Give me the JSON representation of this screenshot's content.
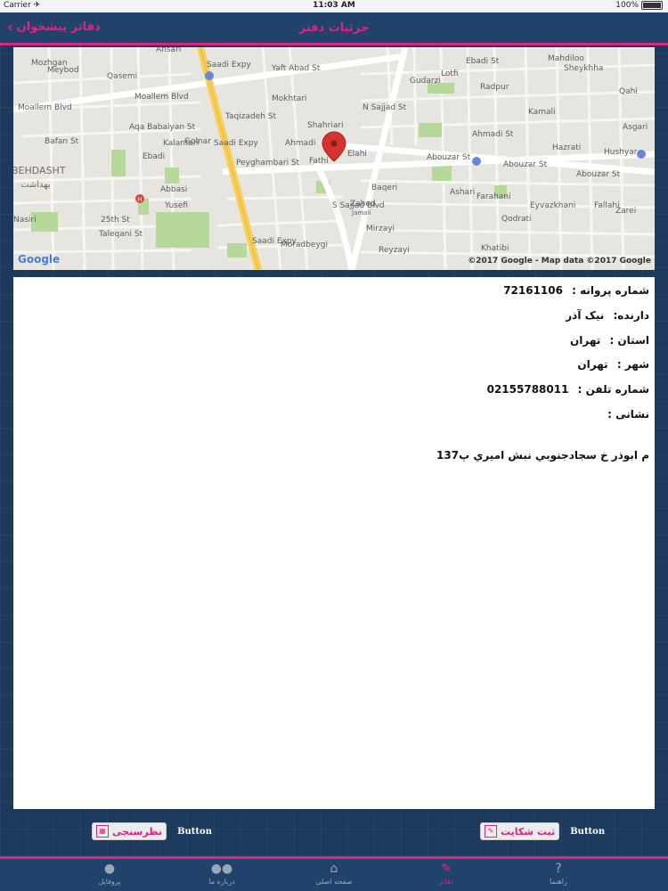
{
  "status_bar": {
    "carrier": "Carrier ✈",
    "time": "11:03 AM",
    "battery": "100%"
  },
  "navbar": {
    "back_label": "دفاتر پیشخوان",
    "title": "جزئیات دفتر"
  },
  "map": {
    "labels": {
      "behdasht": "BEHDASHT",
      "behdasht_fa": "بهداشت",
      "yaft_abad": "Yaft Abad St",
      "qasemi": "Qasemi",
      "moallem": "Moallem Blvd",
      "moallem2": "Moallem Blvd",
      "aqa_babaiyan": "Aqa Babaiyan St",
      "golnar": "Golnar",
      "taqizadeh": "Taqizadeh St",
      "peyghambari": "Peyghambari St",
      "fathi": "Fathi",
      "ahmadi": "Ahmadi",
      "elahi": "Elahi",
      "abouzar1": "Abouzar St",
      "abouzar2": "Abouzar St",
      "abouzar3": "Abouzar St",
      "abbasi": "Abbasi",
      "yusefi": "Yusefi",
      "st25": "25th St",
      "taleqani": "Taleqani St",
      "nasiri": "Nasiri",
      "moradbeygi": "Moradbeygi",
      "reyzayi": "Reyzayi",
      "zahed": "Zahed",
      "baqeri": "Baqeri",
      "mirzayi": "Mirzayi",
      "jamali": "Jamali",
      "lotfi": "Lotfi",
      "radpur": "Radpur",
      "gudarzi": "Gudarzi",
      "ebadi": "Ebadi St",
      "mahdiloo": "Mahdiloo",
      "sheykhha": "Sheykhha",
      "qahi": "Qahi",
      "hazrati": "Hazrati",
      "hushyar": "Hushyar",
      "asgari": "Asgari",
      "kamali": "Kamali",
      "ahmadieh": "Ahmadi St",
      "ashari": "Ashari",
      "farahani": "Farahani",
      "qodrati": "Qodrati",
      "eyvazkhani": "Eyvazkhani",
      "fallahi": "Fallahi",
      "zarei": "Zarei",
      "khatibi": "Khatibi",
      "ansari": "Ansari",
      "mozhgan": "Mozhgan",
      "meybod": "Meybod",
      "bafan": "Bafan St",
      "ebadi2": "Ebadi",
      "kalantari": "Kalantari",
      "sadi1": "Saadi Expy",
      "sadi2": "Saadi Expy",
      "sadi3": "Saadi Expy",
      "sajjad": "S Sajjad Blvd",
      "nsajjad": "N Sajjad St",
      "mokhtari": "Mokhtari",
      "shahriari": "Shahriari",
      "google": "Google",
      "attribution": "©2017 Google - Map data ©2017 Google"
    }
  },
  "details": {
    "license_label": "شماره پروانه :",
    "license_value": "72161106",
    "owner_label": "دارنده:",
    "owner_value": "نیک آذر",
    "province_label": "استان :",
    "province_value": "تهران",
    "city_label": "شهر :",
    "city_value": "تهران",
    "phone_label": "شماره تلفن :",
    "phone_value": "02155788011",
    "address_label": "نشانی :",
    "address_value": "م ابوذر خ سجادجنوبي نبش اميري پ137"
  },
  "buttons": {
    "left_text": "Button",
    "survey_label": "نظرسنجی",
    "right_text": "Button",
    "complaint_label": "ثبت شکایت"
  },
  "tabs": [
    {
      "label": "راهنما",
      "icon": "help-icon"
    },
    {
      "label": "دفاتر",
      "icon": "pen-icon"
    },
    {
      "label": "صفحه اصلی",
      "icon": "home-icon"
    },
    {
      "label": "درباره ما",
      "icon": "people-icon"
    },
    {
      "label": "پروفایل",
      "icon": "user-icon"
    }
  ],
  "colors": {
    "accent": "#e0247c",
    "navbar": "#21436b",
    "background": "#1d3a5c"
  }
}
